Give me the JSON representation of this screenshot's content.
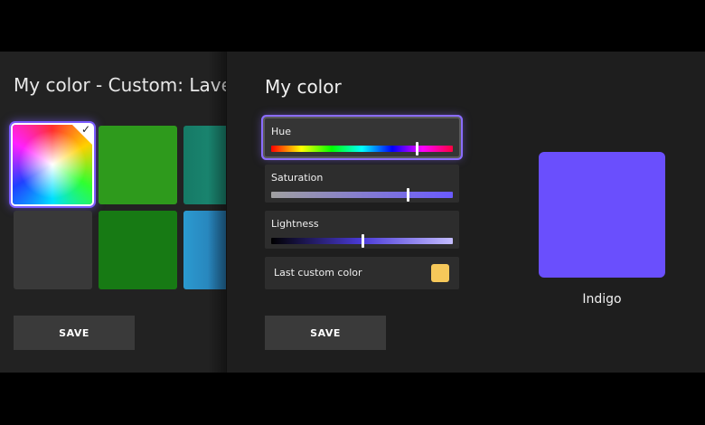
{
  "background_panel": {
    "title": "My color - Custom: Lavender",
    "save_label": "SAVE",
    "tiles": [
      {
        "name": "custom",
        "selected": true
      },
      {
        "name": "green",
        "color": "#2e9a1c"
      },
      {
        "name": "teal",
        "color": "#167a66"
      },
      {
        "name": "gray",
        "color": "#393939"
      },
      {
        "name": "dark-green",
        "color": "#177a14"
      },
      {
        "name": "blue",
        "color": "#2b8cc4"
      }
    ]
  },
  "color_panel": {
    "title": "My color",
    "hue": {
      "label": "Hue",
      "value": 0.8
    },
    "saturation": {
      "label": "Saturation",
      "value": 0.75
    },
    "lightness": {
      "label": "Lightness",
      "value": 0.5
    },
    "last_custom": {
      "label": "Last custom color",
      "color": "#f6c85a"
    },
    "save_label": "SAVE",
    "preview": {
      "name": "Indigo",
      "color": "#6a4ffd"
    }
  },
  "accent_color": "#7a5cff"
}
